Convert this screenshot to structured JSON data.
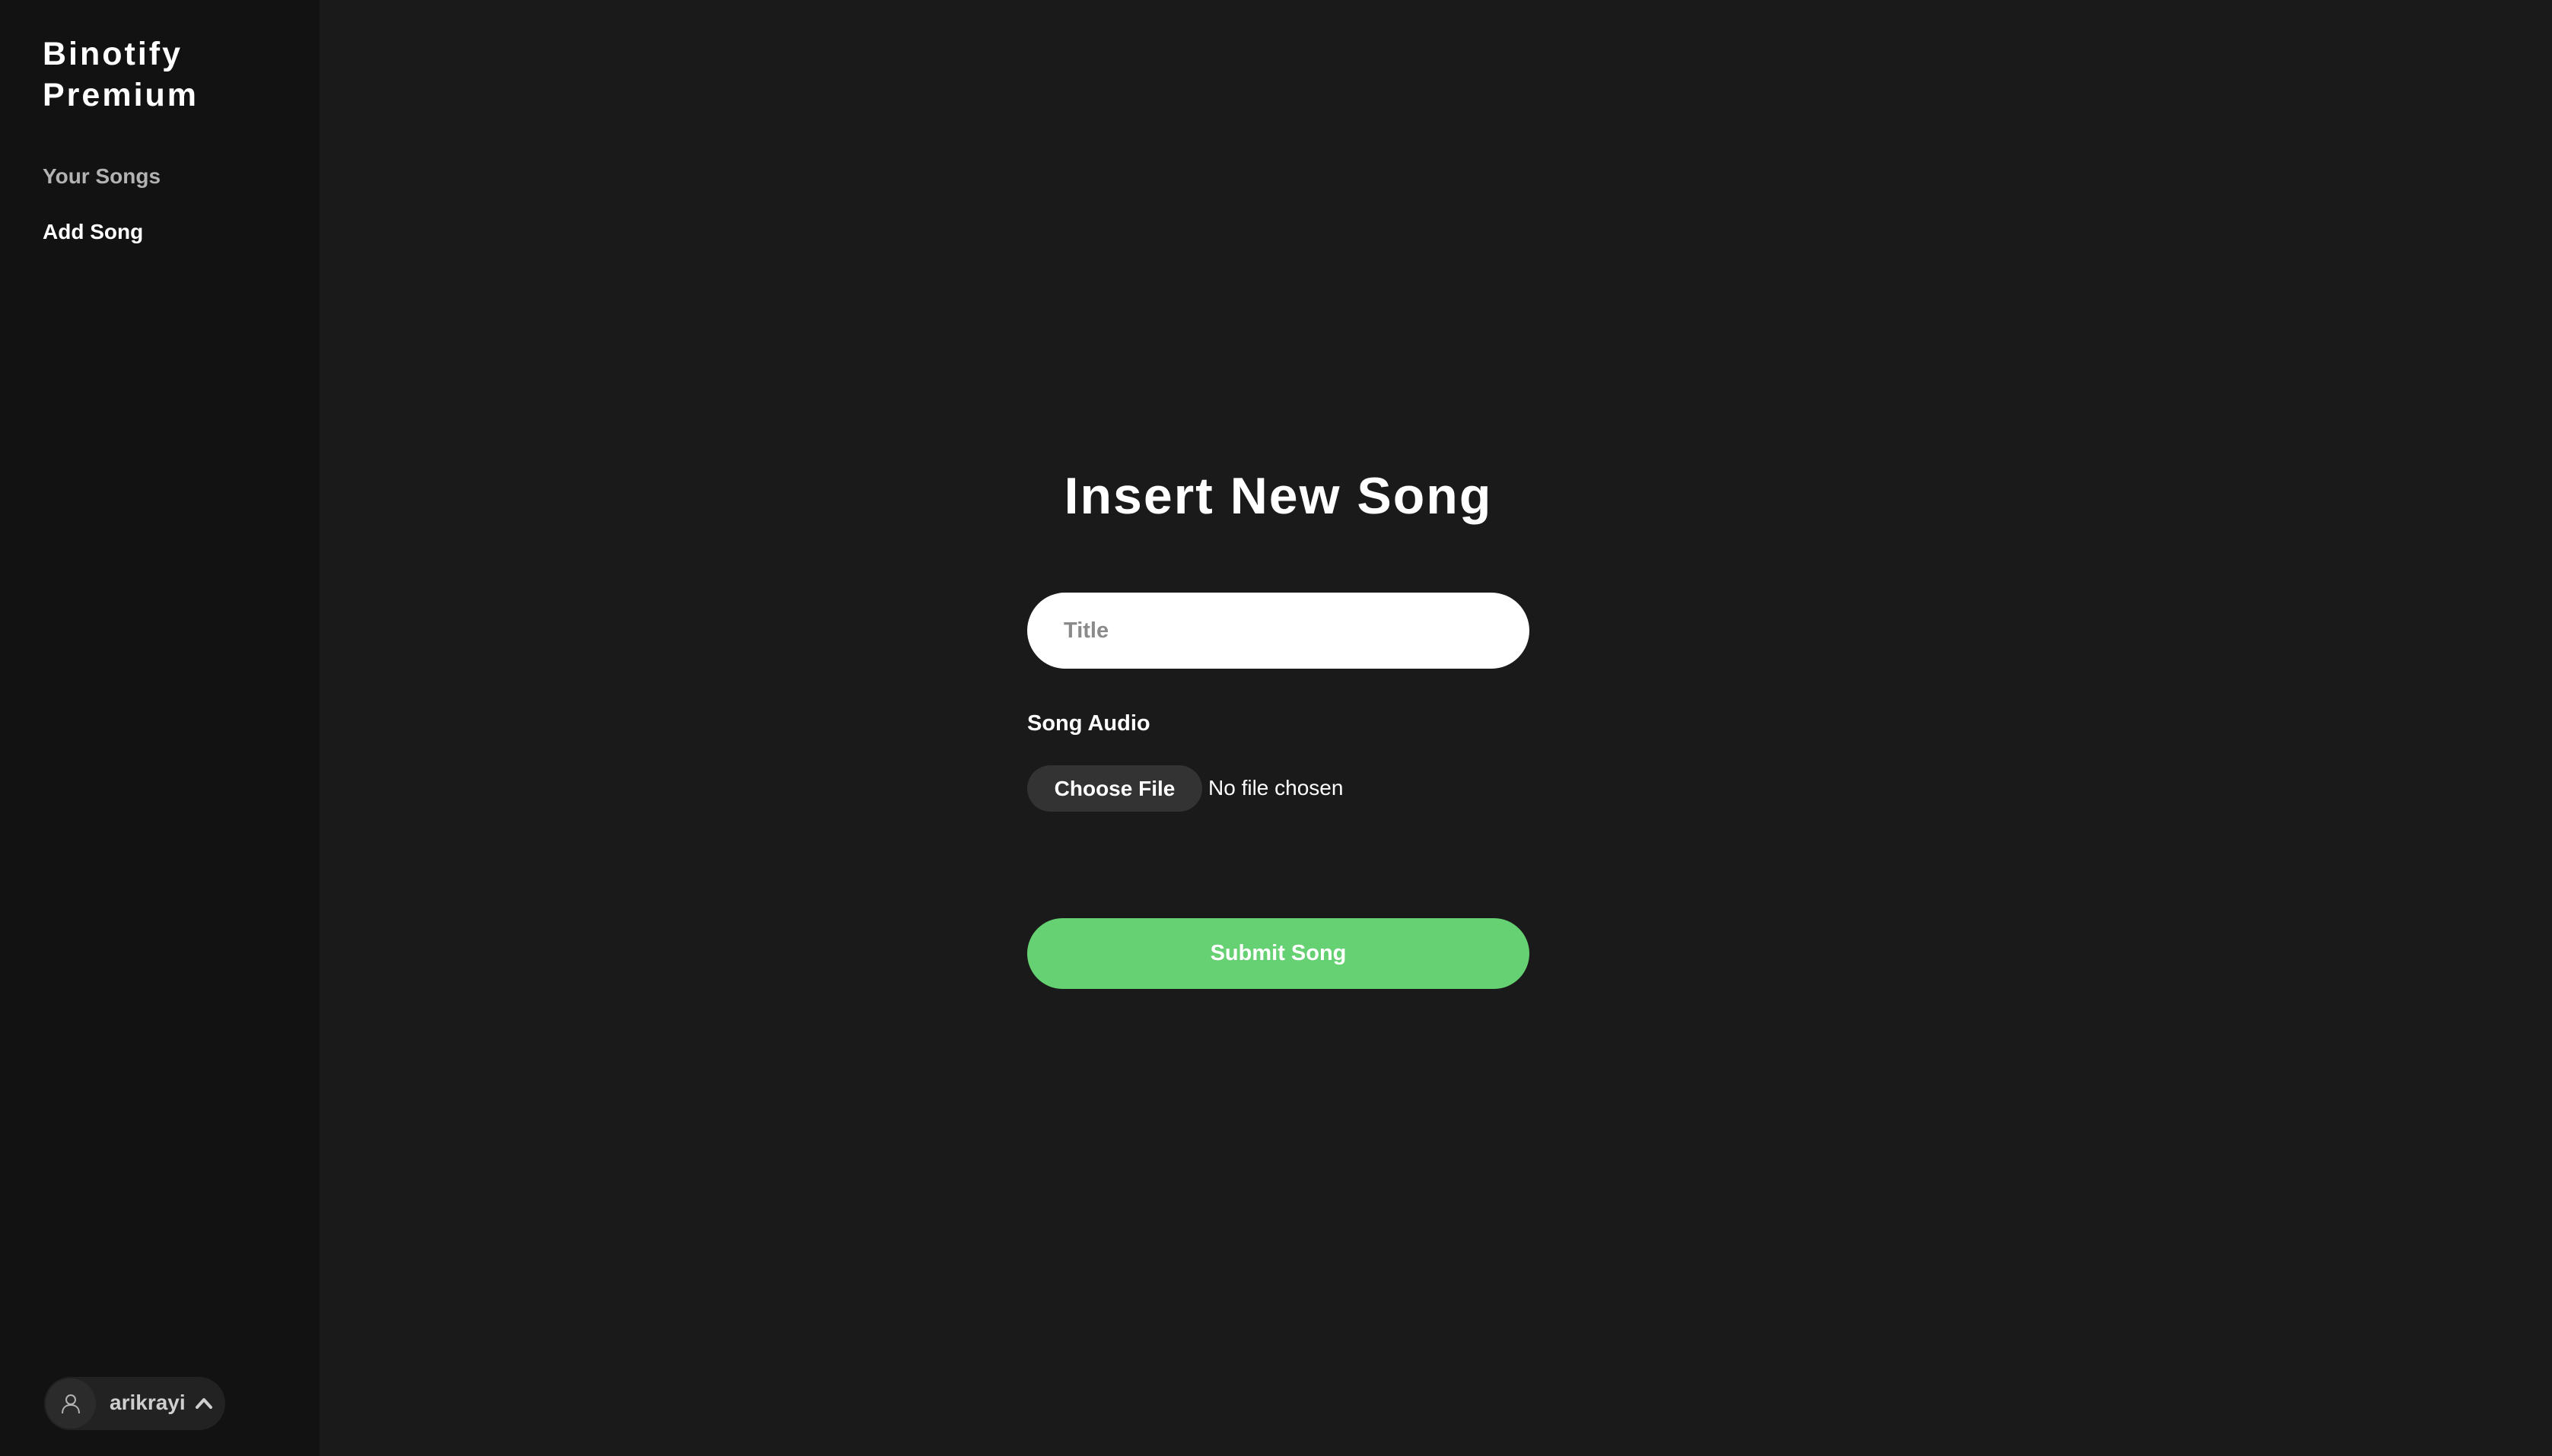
{
  "sidebar": {
    "brand": "Binotify Premium",
    "items": [
      {
        "label": "Your Songs",
        "active": false
      },
      {
        "label": "Add Song",
        "active": true
      }
    ],
    "user": {
      "username": "arikrayi",
      "avatar_icon": "user-icon",
      "toggle_icon": "chevron-up-icon"
    }
  },
  "main": {
    "title": "Insert New Song",
    "title_input": {
      "placeholder": "Title",
      "value": ""
    },
    "audio_label": "Song Audio",
    "file": {
      "button_label": "Choose File",
      "status": "No file chosen"
    },
    "submit_label": "Submit Song"
  },
  "colors": {
    "background": "#1a1a1a",
    "sidebar": "#121212",
    "accent": "#65d172"
  }
}
